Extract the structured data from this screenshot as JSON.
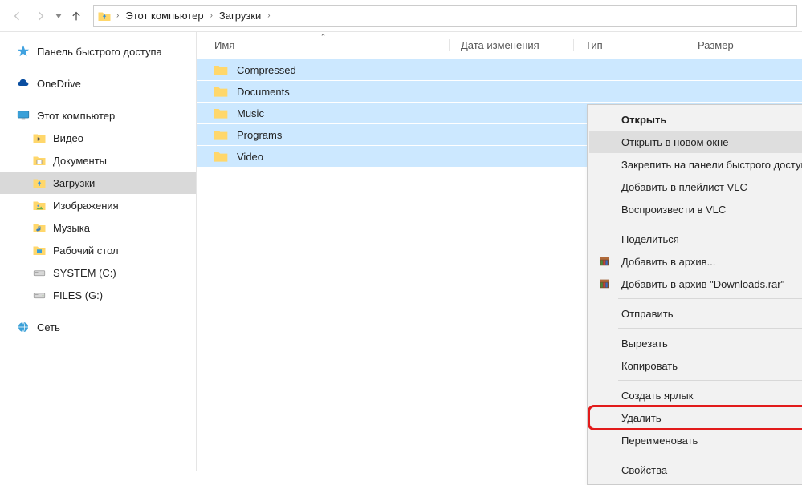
{
  "nav": {
    "breadcrumb": [
      "Этот компьютер",
      "Загрузки"
    ]
  },
  "sidebar": {
    "items": [
      {
        "label": "Панель быстрого доступа",
        "icon": "star",
        "indent": false
      },
      {
        "gap": true
      },
      {
        "label": "OneDrive",
        "icon": "onedrive",
        "indent": false
      },
      {
        "gap": true
      },
      {
        "label": "Этот компьютер",
        "icon": "pc",
        "indent": false
      },
      {
        "label": "Видео",
        "icon": "lib-video",
        "indent": true
      },
      {
        "label": "Документы",
        "icon": "lib-docs",
        "indent": true
      },
      {
        "label": "Загрузки",
        "icon": "lib-downloads",
        "indent": true,
        "selected": true
      },
      {
        "label": "Изображения",
        "icon": "lib-images",
        "indent": true
      },
      {
        "label": "Музыка",
        "icon": "lib-music",
        "indent": true
      },
      {
        "label": "Рабочий стол",
        "icon": "lib-desktop",
        "indent": true
      },
      {
        "label": "SYSTEM (C:)",
        "icon": "drive",
        "indent": true
      },
      {
        "label": "FILES (G:)",
        "icon": "drive",
        "indent": true
      },
      {
        "gap": true
      },
      {
        "label": "Сеть",
        "icon": "network",
        "indent": false
      }
    ]
  },
  "columns": {
    "name": "Имя",
    "date": "Дата изменения",
    "type": "Тип",
    "size": "Размер"
  },
  "files": [
    {
      "name": "Compressed"
    },
    {
      "name": "Documents"
    },
    {
      "name": "Music"
    },
    {
      "name": "Programs"
    },
    {
      "name": "Video"
    }
  ],
  "context_menu": {
    "items": [
      {
        "label": "Открыть",
        "bold": true
      },
      {
        "label": "Открыть в новом окне",
        "hovered": true
      },
      {
        "label": "Закрепить на панели быстрого доступа"
      },
      {
        "label": "Добавить в плейлист VLC"
      },
      {
        "label": "Воспроизвести в VLC"
      },
      {
        "sep": true
      },
      {
        "label": "Поделиться",
        "submenu": true
      },
      {
        "label": "Добавить в архив...",
        "icon": "winrar"
      },
      {
        "label": "Добавить в архив \"Downloads.rar\"",
        "icon": "winrar"
      },
      {
        "sep": true
      },
      {
        "label": "Отправить",
        "submenu": true
      },
      {
        "sep": true
      },
      {
        "label": "Вырезать"
      },
      {
        "label": "Копировать"
      },
      {
        "sep": true
      },
      {
        "label": "Создать ярлык"
      },
      {
        "label": "Удалить",
        "highlighted": true
      },
      {
        "label": "Переименовать"
      },
      {
        "sep": true
      },
      {
        "label": "Свойства"
      }
    ]
  }
}
